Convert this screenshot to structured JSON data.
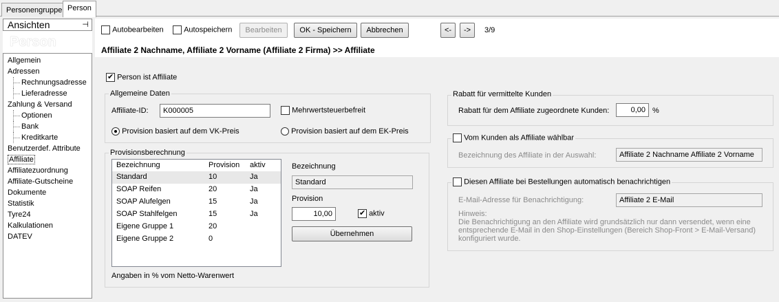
{
  "tabs": [
    "Personengruppe",
    "Person"
  ],
  "left": {
    "ansichten_label": "Ansichten",
    "pin_icon": "pin-icon",
    "header": "Person",
    "tree": [
      {
        "label": "Allgemein",
        "sub": false
      },
      {
        "label": "Adressen",
        "sub": false
      },
      {
        "label": "Rechnungsadresse",
        "sub": true
      },
      {
        "label": "Lieferadresse",
        "sub": true
      },
      {
        "label": "Zahlung & Versand",
        "sub": false
      },
      {
        "label": "Optionen",
        "sub": true
      },
      {
        "label": "Bank",
        "sub": true
      },
      {
        "label": "Kreditkarte",
        "sub": true
      },
      {
        "label": "Benutzerdef. Attribute",
        "sub": false
      },
      {
        "label": "Affiliate",
        "sub": false,
        "selected": true
      },
      {
        "label": "Affiliatezuordnung",
        "sub": false
      },
      {
        "label": "Affiliate-Gutscheine",
        "sub": false
      },
      {
        "label": "Dokumente",
        "sub": false
      },
      {
        "label": "Statistik",
        "sub": false
      },
      {
        "label": "Tyre24",
        "sub": false
      },
      {
        "label": "Kalkulationen",
        "sub": false
      },
      {
        "label": "DATEV",
        "sub": false
      }
    ]
  },
  "toolbar": {
    "autobearbeiten": "Autobearbeiten",
    "autospeichern": "Autospeichern",
    "bearbeiten": "Bearbeiten",
    "ok_speichern": "OK - Speichern",
    "abbrechen": "Abbrechen",
    "prev": "<-",
    "next": "->",
    "position": "3/9"
  },
  "breadcrumb": "Affiliate 2 Nachname, Affiliate 2 Vorname (Affiliate 2 Firma) >> Affiliate",
  "person_ist_affiliate": "Person ist Affiliate",
  "allgemeine": {
    "title": "Allgemeine Daten",
    "id_label": "Affiliate-ID:",
    "id_value": "K000005",
    "mwst_label": "Mehrwertsteuerbefreit",
    "radio_vk": "Provision basiert auf dem VK-Preis",
    "radio_ek": "Provision basiert auf dem EK-Preis"
  },
  "provision": {
    "title": "Provisionsberechnung",
    "columns": [
      "Bezeichnung",
      "Provision",
      "aktiv"
    ],
    "rows": [
      [
        "Standard",
        "10",
        "Ja"
      ],
      [
        "SOAP Reifen",
        "20",
        "Ja"
      ],
      [
        "SOAP Alufelgen",
        "15",
        "Ja"
      ],
      [
        "SOAP Stahlfelgen",
        "15",
        "Ja"
      ],
      [
        "Eigene Gruppe 1",
        "20",
        ""
      ],
      [
        "Eigene Gruppe 2",
        "0",
        ""
      ]
    ],
    "bez_label": "Bezeichnung",
    "bez_value": "Standard",
    "prov_label": "Provision",
    "prov_value": "10,00",
    "aktiv_label": "aktiv",
    "uebernehmen": "Übernehmen",
    "footnote": "Angaben in % vom Netto-Warenwert"
  },
  "rabatt": {
    "title": "Rabatt für vermittelte Kunden",
    "label": "Rabatt für dem Affiliate zugeordnete Kunden:",
    "value": "0,00",
    "unit": "%"
  },
  "waehlbar": {
    "title": "Vom Kunden als Affiliate wählbar",
    "label": "Bezeichnung des Affiliate in der Auswahl:",
    "value": "Affiliate 2 Nachname Affiliate 2 Vorname"
  },
  "benachrichtigen": {
    "title": "Diesen Affiliate bei Bestellungen automatisch benachrichtigen",
    "label": "E-Mail-Adresse für Benachrichtigung:",
    "value": "Affiliate 2 E-Mail",
    "hint_title": "Hinweis:",
    "hint_lines": [
      "Die Benachrichtigung an den Affiliate wird grundsätzlich nur dann versendet, wenn eine",
      "entsprechende E-Mail in den Shop-Einstellungen (Bereich Shop-Front > E-Mail-Versand)",
      "konfiguriert wurde."
    ]
  }
}
